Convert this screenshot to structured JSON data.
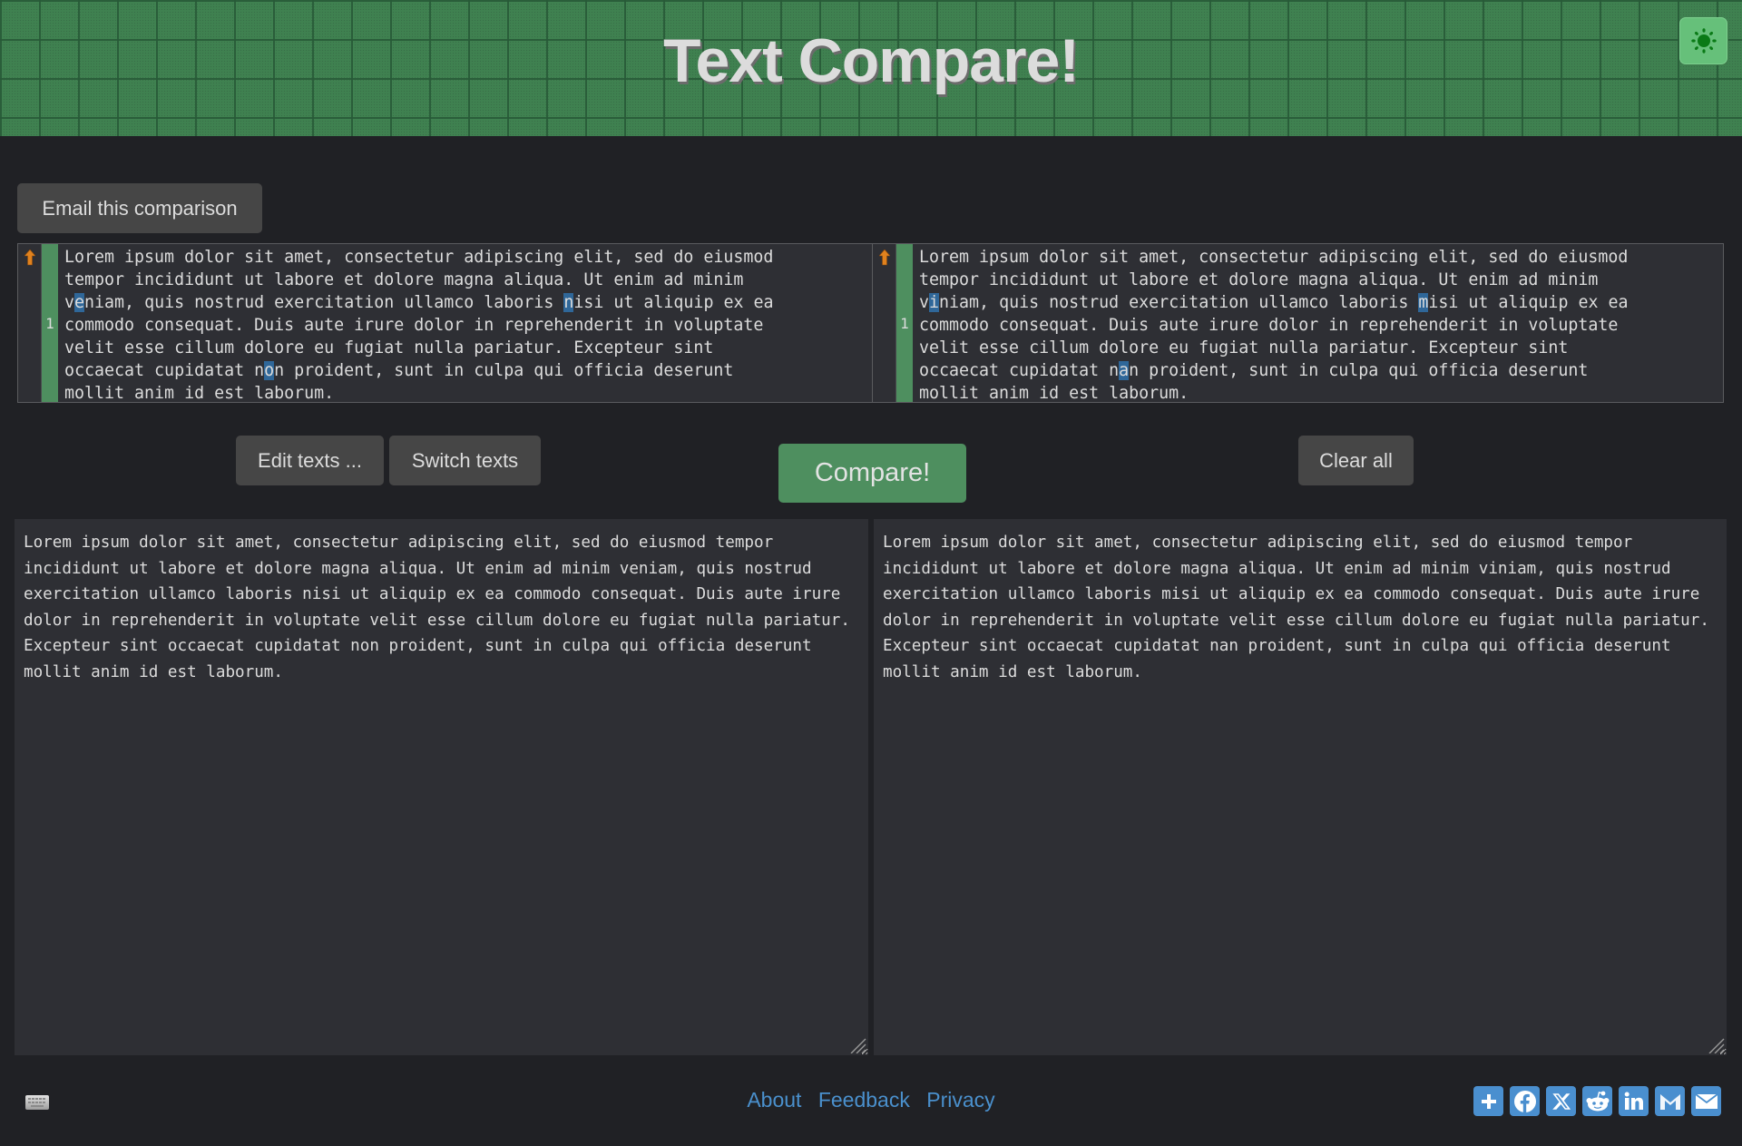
{
  "header": {
    "title": "Text Compare!",
    "theme_toggle_icon": "sun-icon"
  },
  "toolbar": {
    "email_label": "Email this comparison",
    "edit_label": "Edit texts ...",
    "switch_label": "Switch texts",
    "compare_label": "Compare!",
    "clear_label": "Clear all"
  },
  "diff": {
    "line_number": "1",
    "left": {
      "lines": [
        "Lorem ipsum dolor sit amet, consectetur adipiscing elit, sed do eiusmod",
        "tempor incididunt ut labore et dolore magna aliqua. Ut enim ad minim",
        [
          "v",
          "e",
          "niam, quis nostrud exercitation ullamco laboris ",
          "n",
          "isi ut aliquip ex ea"
        ],
        "commodo consequat. Duis aute irure dolor in reprehenderit in voluptate",
        "velit esse cillum dolore eu fugiat nulla pariatur. Excepteur sint",
        [
          "occaecat cupidatat n",
          "o",
          "n proident, sunt in culpa qui officia deserunt"
        ],
        "mollit anim id est laborum."
      ]
    },
    "right": {
      "lines": [
        "Lorem ipsum dolor sit amet, consectetur adipiscing elit, sed do eiusmod",
        "tempor incididunt ut labore et dolore magna aliqua. Ut enim ad minim",
        [
          "v",
          "i",
          "niam, quis nostrud exercitation ullamco laboris ",
          "m",
          "isi ut aliquip ex ea"
        ],
        "commodo consequat. Duis aute irure dolor in reprehenderit in voluptate",
        "velit esse cillum dolore eu fugiat nulla pariatur. Excepteur sint",
        [
          "occaecat cupidatat n",
          "a",
          "n proident, sunt in culpa qui officia deserunt"
        ],
        "mollit anim id est laborum."
      ]
    },
    "colors": {
      "added_gutter": "#4e8f5f",
      "char_highlight": "#2f6799",
      "arrow": "#e0821e"
    }
  },
  "inputs": {
    "left_text": "Lorem ipsum dolor sit amet, consectetur adipiscing elit, sed do eiusmod tempor incididunt ut labore et dolore magna aliqua. Ut enim ad minim veniam, quis nostrud exercitation ullamco laboris nisi ut aliquip ex ea commodo consequat. Duis aute irure dolor in reprehenderit in voluptate velit esse cillum dolore eu fugiat nulla pariatur. Excepteur sint occaecat cupidatat non proident, sunt in culpa qui officia deserunt mollit anim id est laborum.",
    "right_text": "Lorem ipsum dolor sit amet, consectetur adipiscing elit, sed do eiusmod tempor incididunt ut labore et dolore magna aliqua. Ut enim ad minim viniam, quis nostrud exercitation ullamco laboris misi ut aliquip ex ea commodo consequat. Duis aute irure dolor in reprehenderit in voluptate velit esse cillum dolore eu fugiat nulla pariatur. Excepteur sint occaecat cupidatat nan proident, sunt in culpa qui officia deserunt mollit anim id est laborum."
  },
  "footer": {
    "links": [
      "About",
      "Feedback",
      "Privacy"
    ],
    "keyboard_icon": "keyboard-icon",
    "share_icons": [
      "share-plus-icon",
      "facebook-icon",
      "x-icon",
      "reddit-icon",
      "linkedin-icon",
      "gmail-icon",
      "email-icon"
    ],
    "link_color": "#4a90cd"
  }
}
